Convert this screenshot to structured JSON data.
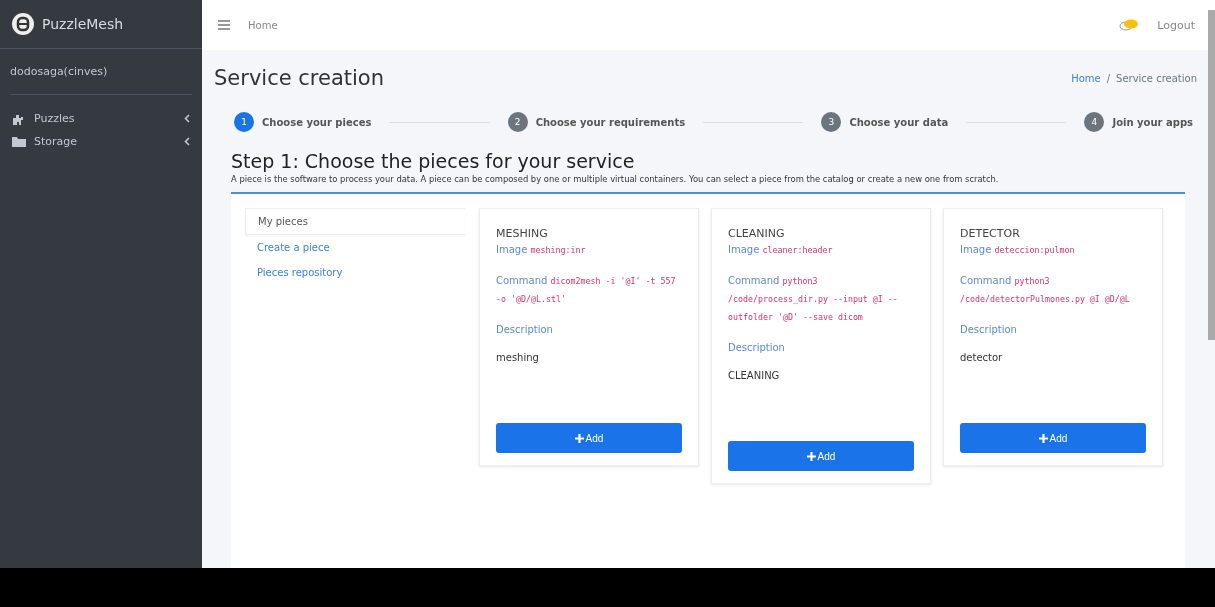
{
  "brand": {
    "name": "PuzzleMesh"
  },
  "user": "dodosaga(cinves)",
  "sidebar": {
    "items": [
      {
        "label": "Puzzles",
        "kind": "puzzle"
      },
      {
        "label": "Storage",
        "kind": "folder"
      }
    ]
  },
  "topbar": {
    "home": "Home",
    "logout": "Logout"
  },
  "page": {
    "title": "Service creation",
    "breadcrumb": [
      "Home",
      "Service creation"
    ],
    "separator": "/"
  },
  "steps": [
    {
      "number": "1",
      "label": "Choose your pieces",
      "selected": true
    },
    {
      "number": "2",
      "label": "Choose your requirements",
      "selected": false
    },
    {
      "number": "3",
      "label": "Choose your data",
      "selected": false
    },
    {
      "number": "4",
      "label": "Join your apps",
      "selected": false
    }
  ],
  "step_title": "Step 1: Choose the pieces for your service",
  "step_text": "A piece is the software to process your data. A piece can be composed by one or multiple virtual containers. You can select a piece from the catalog or create a new one from scratch.",
  "piece_nav": [
    {
      "label": "My pieces",
      "selected": true
    },
    {
      "label": "Create a piece",
      "selected": false
    },
    {
      "label": "Pieces repository",
      "selected": false
    }
  ],
  "pieces": [
    {
      "name": "MESHING",
      "image_label": "Image",
      "image": "meshing:inr",
      "command_label": "Command",
      "command": "dicom2mesh -i '@I' -t 557 -o '@D/@L.stl'",
      "description_label": "Description",
      "description": "meshing",
      "button": "Add"
    },
    {
      "name": "CLEANING",
      "image_label": "Image",
      "image": "cleaner:header",
      "command_label": "Command",
      "command": "python3 /code/process_dir.py --input @I --outfolder '@D' --save dicom",
      "description_label": "Description",
      "description": "CLEANING",
      "button": "Add"
    },
    {
      "name": "DETECTOR",
      "image_label": "Image",
      "image": "deteccion:pulmon",
      "command_label": "Command",
      "command": "python3 /code/detectorPulmones.py @I @D/@L",
      "description_label": "Description",
      "description": "detector",
      "button": "Add"
    }
  ]
}
